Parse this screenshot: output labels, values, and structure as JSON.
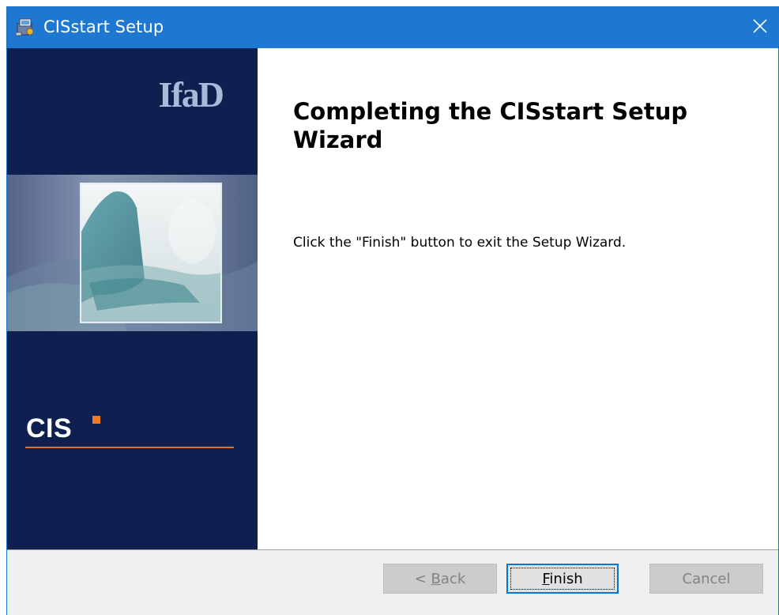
{
  "window": {
    "title": "CISstart Setup",
    "icon": "installer-icon",
    "close_icon": "close-icon",
    "titlebar_color": "#1e78d2"
  },
  "side_panel": {
    "logo_text": "IfaD",
    "brand_label": "CIS",
    "accent_color": "#f07a1e",
    "background_color": "#0f1f4f"
  },
  "main": {
    "heading": "Completing the CISstart Setup Wizard",
    "message": "Click the \"Finish\" button to exit the Setup Wizard."
  },
  "buttons": {
    "back": {
      "mnemonic_prefix": "< ",
      "mnemonic": "B",
      "rest": "ack",
      "enabled": false
    },
    "finish": {
      "mnemonic": "F",
      "rest": "inish",
      "enabled": true,
      "focused": true
    },
    "cancel": {
      "label": "Cancel",
      "enabled": false
    }
  }
}
